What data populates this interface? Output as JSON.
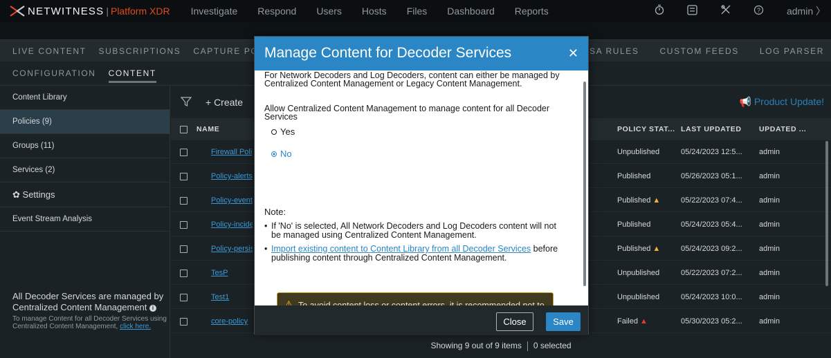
{
  "app": {
    "brand": "NETWITNESS",
    "separator": "|",
    "product": "Platform XDR"
  },
  "top_nav": [
    "Investigate",
    "Respond",
    "Users",
    "Hosts",
    "Files",
    "Dashboard",
    "Reports"
  ],
  "top_icons": [
    "stopwatch-icon",
    "settings-panel-icon",
    "tools-icon",
    "help-icon"
  ],
  "user_menu": "admin",
  "secondary_tabs_left": [
    "LIVE CONTENT",
    "SUBSCRIPTIONS",
    "CAPTURE PO"
  ],
  "secondary_tabs_right": [
    "ESA RULES",
    "CUSTOM FEEDS",
    "LOG PARSER"
  ],
  "tertiary_tabs": [
    "CONFIGURATION",
    "CONTENT"
  ],
  "sidebar": {
    "items": [
      "Content Library",
      "Policies (9)",
      "Groups (11)",
      "Services (2)"
    ],
    "settings": "Settings",
    "settings_items": [
      "Event Stream Analysis"
    ],
    "footer_title": "All Decoder Services are managed by Centralized Content Management",
    "footer_text": "To manage Content for all Decoder Services using Centralized Content Management,",
    "footer_link": "click here."
  },
  "toolbar": {
    "create_label": "+ Create",
    "product_update": "Product Update!"
  },
  "table": {
    "columns": [
      "NAME",
      "POLICY STAT...",
      "LAST UPDATED",
      "UPDATED ..."
    ],
    "rows": [
      {
        "name": "Firewall Poli",
        "status": "Unpublished",
        "updated": "05/24/2023 12:5...",
        "by": "admin"
      },
      {
        "name": "Policy-alerts",
        "status": "Published",
        "updated": "05/26/2023 05:1...",
        "by": "admin"
      },
      {
        "name": "Policy-event",
        "status": "Published",
        "warn": "warning",
        "updated": "05/22/2023 07:4...",
        "by": "admin"
      },
      {
        "name": "Policy-incide",
        "status": "Published",
        "updated": "05/24/2023 05:4...",
        "by": "admin"
      },
      {
        "name": "Policy-persis",
        "status": "Published",
        "warn": "warning",
        "updated": "05/24/2023 09:2...",
        "by": "admin"
      },
      {
        "name": "TesP",
        "status": "Unpublished",
        "updated": "05/22/2023 07:2...",
        "by": "admin"
      },
      {
        "name": "Test1",
        "status": "Unpublished",
        "updated": "05/24/2023 10:0...",
        "by": "admin"
      },
      {
        "name": "core-policy",
        "status": "Failed",
        "warn": "error",
        "updated": "05/30/2023 05:2...",
        "by": "admin"
      }
    ],
    "footer_showing": "Showing 9 out of 9 items",
    "footer_selected": "0 selected"
  },
  "modal": {
    "title": "Manage Content for Decoder Services",
    "intro": "For Network Decoders and Log Decoders, content can either be managed by Centralized Content Management or Legacy Content Management.",
    "question": "Allow Centralized Content Management to manage content for all Decoder Services",
    "option_yes": "Yes",
    "option_no": "No",
    "selected_option": "No",
    "note_heading": "Note:",
    "bullet1": "If 'No' is selected, All Network Decoders and Log Decoders content will not be managed using Centralized Content Management.",
    "bullet2_link": "Import existing content to Content Library from all Decoder Services",
    "bullet2_rest": "before publishing content through Centralized Content Management.",
    "warning": "To avoid content loss or content errors, it is recommended not to enable or disable Centralized Content Management frequently",
    "close_label": "Close",
    "save_label": "Save"
  },
  "colors": {
    "accent": "#2a86c4",
    "brand_red": "#e0491f",
    "warning": "#f0b429",
    "error": "#e53935"
  }
}
